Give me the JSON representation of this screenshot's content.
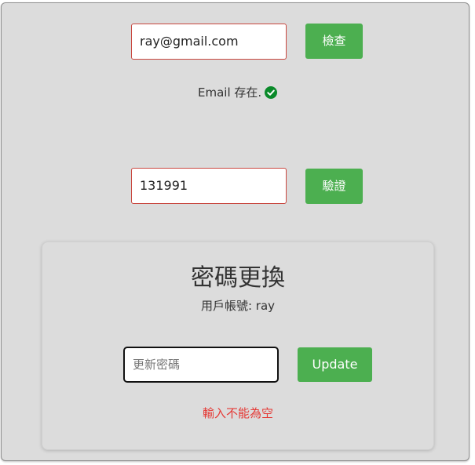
{
  "email_section": {
    "email_value": "ray@gmail.com",
    "check_button_label": "檢查",
    "status_text": "Email 存在.",
    "status_icon": "check-circle-icon",
    "status_color": "#0a8a2a"
  },
  "code_section": {
    "code_value": "131991",
    "verify_button_label": "驗證"
  },
  "password_card": {
    "title": "密碼更換",
    "account_label": "用戶帳號: ray",
    "password_placeholder": "更新密碼",
    "update_button_label": "Update",
    "error_text": "輸入不能為空",
    "error_color": "#e53935"
  },
  "colors": {
    "button_green": "#4caf50",
    "background_gray": "#dcdcdc",
    "input_border_red": "#c9473f"
  }
}
